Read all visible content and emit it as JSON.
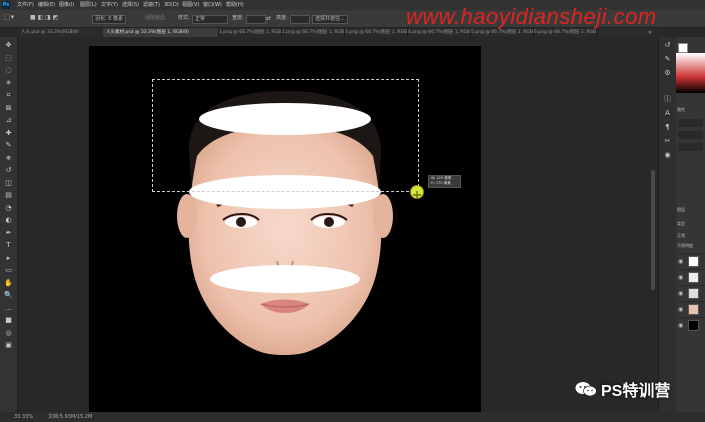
{
  "app": {
    "logo": "Ps"
  },
  "menubar": {
    "items": [
      "文件(F)",
      "编辑(E)",
      "图像(I)",
      "图层(L)",
      "文字(Y)",
      "选择(S)",
      "滤镜(T)",
      "3D(D)",
      "视图(V)",
      "窗口(W)",
      "帮助(H)"
    ]
  },
  "watermark": {
    "url": "www.haoyidiansheji.com",
    "wechat": "PS特训营"
  },
  "options": {
    "feather": "羽化: 0 像素",
    "antialias": "消除锯齿",
    "style_label": "样式:",
    "style_value": "正常",
    "width_label": "宽度:",
    "height_label": "高度:",
    "select_mask": "选择并遮住..."
  },
  "tabs": [
    {
      "label": "人头.psd @ 33.3%(RGB/8)",
      "active": false
    },
    {
      "label": "人头素材.psd @ 33.3%(图层 1, RGB/8)",
      "active": true
    },
    {
      "label": "1.png @ 66.7%(图层 1, RGB/8)",
      "active": false
    },
    {
      "label": "2.png @ 66.7%(图层 1, RGB/8)",
      "active": false
    },
    {
      "label": "3.png @ 66.7%(图层 1, RGB/8)",
      "active": false
    },
    {
      "label": "4.png @ 66.7%(图层 1, RGB/8)",
      "active": false
    },
    {
      "label": "5.png @ 66.7%(图层 1, RGB/8)",
      "active": false
    },
    {
      "label": "6.png @ 66.7%(图层 1, RGB/8)",
      "active": false
    }
  ],
  "tools": [
    "move-tool-icon",
    "marquee-tool-icon",
    "lasso-tool-icon",
    "magic-wand-icon",
    "crop-tool-icon",
    "frame-tool-icon",
    "eyedropper-icon",
    "healing-brush-icon",
    "brush-tool-icon",
    "clone-stamp-icon",
    "history-brush-icon",
    "eraser-icon",
    "gradient-icon",
    "blur-icon",
    "dodge-icon",
    "pen-tool-icon",
    "type-tool-icon",
    "path-select-icon",
    "shape-tool-icon",
    "hand-tool-icon",
    "zoom-tool-icon",
    "more-tools-icon",
    "foreground-color-icon",
    "quick-mask-icon",
    "screen-mode-icon"
  ],
  "tool_glyphs": [
    "✥",
    "⬚",
    "◌",
    "✳",
    "⌗",
    "⊠",
    "⊿",
    "✚",
    "✎",
    "⎈",
    "↺",
    "◫",
    "▤",
    "◔",
    "◐",
    "✒",
    "T",
    "▸",
    "▭",
    "✋",
    "🔍",
    "…",
    "■",
    "◎",
    "▣"
  ],
  "tooltip": {
    "width": "W: 425 像素",
    "height": "H: 170 像素"
  },
  "right_panel": {
    "properties_title": "属性",
    "layers_title": "图层",
    "kind_label": "类型",
    "blend_mode": "正常",
    "opacity_label": "不透明度",
    "layer_names": [
      "图层 3",
      "图层 2",
      "图层 1",
      "形状",
      "背景"
    ]
  },
  "colors": {
    "accent": "#31a8ff",
    "watermark_red": "#e0241f",
    "cursor": "#d8e43a"
  },
  "statusbar": {
    "zoom": "33.33%",
    "doc": "文档:5.93M/15.2M"
  }
}
